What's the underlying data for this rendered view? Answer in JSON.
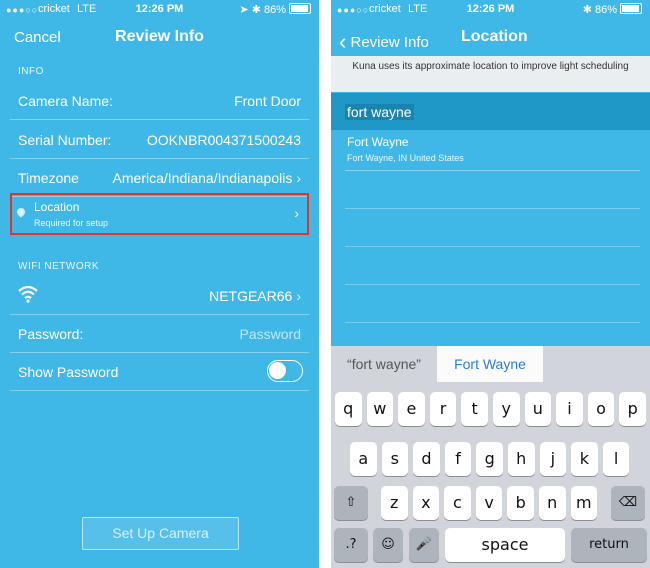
{
  "status": {
    "signal": "●●●○○",
    "carrier": "cricket",
    "network": "LTE",
    "time": "12:26 PM",
    "battery": "86%"
  },
  "left": {
    "nav": {
      "cancel": "Cancel",
      "title": "Review Info"
    },
    "info_header": "INFO",
    "camera_name": {
      "label": "Camera Name:",
      "value": "Front Door"
    },
    "serial": {
      "label": "Serial Number:",
      "value": "OOKNBR004371500243"
    },
    "timezone": {
      "label": "Timezone",
      "value": "America/Indiana/Indianapolis"
    },
    "location": {
      "title": "Location",
      "subtitle": "Required for setup"
    },
    "wifi_header": "WIFI NETWORK",
    "network": {
      "value": "NETGEAR66"
    },
    "password": {
      "label": "Password:",
      "placeholder": "Password"
    },
    "show_password": {
      "label": "Show Password",
      "enabled": false
    },
    "setup_button": "Set Up Camera",
    "chevron": "›"
  },
  "right": {
    "nav": {
      "back": "Review Info",
      "title": "Location",
      "back_glyph": "‹"
    },
    "banner": "Kuna uses its approximate location to improve light scheduling",
    "search_text": "fort wayne",
    "result": {
      "title": "Fort Wayne",
      "subtitle": "Fort Wayne, IN United States"
    },
    "suggestions": {
      "quoted": "“fort wayne”",
      "selected": "Fort Wayne"
    },
    "keyboard": {
      "row1": [
        "q",
        "w",
        "e",
        "r",
        "t",
        "y",
        "u",
        "i",
        "o",
        "p"
      ],
      "row2": [
        "a",
        "s",
        "d",
        "f",
        "g",
        "h",
        "j",
        "k",
        "l"
      ],
      "row3": [
        "z",
        "x",
        "c",
        "v",
        "b",
        "n",
        "m"
      ],
      "shift": "⇧",
      "delete": "⌫",
      "numbers": ".?123",
      "emoji": "☺",
      "mic": "🎤",
      "space": "space",
      "return": "return"
    }
  },
  "colors": {
    "background": "#3fb8e8",
    "highlight": "#1f97c7",
    "location_border": "#e5322b"
  }
}
